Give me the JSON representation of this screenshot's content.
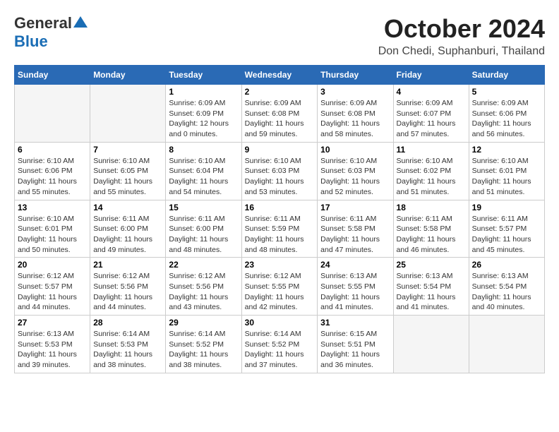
{
  "logo": {
    "general": "General",
    "blue": "Blue"
  },
  "title": "October 2024",
  "location": "Don Chedi, Suphanburi, Thailand",
  "days_of_week": [
    "Sunday",
    "Monday",
    "Tuesday",
    "Wednesday",
    "Thursday",
    "Friday",
    "Saturday"
  ],
  "weeks": [
    [
      {
        "num": "",
        "empty": true
      },
      {
        "num": "",
        "empty": true
      },
      {
        "num": "1",
        "info": "Sunrise: 6:09 AM\nSunset: 6:09 PM\nDaylight: 12 hours and 0 minutes."
      },
      {
        "num": "2",
        "info": "Sunrise: 6:09 AM\nSunset: 6:08 PM\nDaylight: 11 hours and 59 minutes."
      },
      {
        "num": "3",
        "info": "Sunrise: 6:09 AM\nSunset: 6:08 PM\nDaylight: 11 hours and 58 minutes."
      },
      {
        "num": "4",
        "info": "Sunrise: 6:09 AM\nSunset: 6:07 PM\nDaylight: 11 hours and 57 minutes."
      },
      {
        "num": "5",
        "info": "Sunrise: 6:09 AM\nSunset: 6:06 PM\nDaylight: 11 hours and 56 minutes."
      }
    ],
    [
      {
        "num": "6",
        "info": "Sunrise: 6:10 AM\nSunset: 6:06 PM\nDaylight: 11 hours and 55 minutes."
      },
      {
        "num": "7",
        "info": "Sunrise: 6:10 AM\nSunset: 6:05 PM\nDaylight: 11 hours and 55 minutes."
      },
      {
        "num": "8",
        "info": "Sunrise: 6:10 AM\nSunset: 6:04 PM\nDaylight: 11 hours and 54 minutes."
      },
      {
        "num": "9",
        "info": "Sunrise: 6:10 AM\nSunset: 6:03 PM\nDaylight: 11 hours and 53 minutes."
      },
      {
        "num": "10",
        "info": "Sunrise: 6:10 AM\nSunset: 6:03 PM\nDaylight: 11 hours and 52 minutes."
      },
      {
        "num": "11",
        "info": "Sunrise: 6:10 AM\nSunset: 6:02 PM\nDaylight: 11 hours and 51 minutes."
      },
      {
        "num": "12",
        "info": "Sunrise: 6:10 AM\nSunset: 6:01 PM\nDaylight: 11 hours and 51 minutes."
      }
    ],
    [
      {
        "num": "13",
        "info": "Sunrise: 6:10 AM\nSunset: 6:01 PM\nDaylight: 11 hours and 50 minutes."
      },
      {
        "num": "14",
        "info": "Sunrise: 6:11 AM\nSunset: 6:00 PM\nDaylight: 11 hours and 49 minutes."
      },
      {
        "num": "15",
        "info": "Sunrise: 6:11 AM\nSunset: 6:00 PM\nDaylight: 11 hours and 48 minutes."
      },
      {
        "num": "16",
        "info": "Sunrise: 6:11 AM\nSunset: 5:59 PM\nDaylight: 11 hours and 48 minutes."
      },
      {
        "num": "17",
        "info": "Sunrise: 6:11 AM\nSunset: 5:58 PM\nDaylight: 11 hours and 47 minutes."
      },
      {
        "num": "18",
        "info": "Sunrise: 6:11 AM\nSunset: 5:58 PM\nDaylight: 11 hours and 46 minutes."
      },
      {
        "num": "19",
        "info": "Sunrise: 6:11 AM\nSunset: 5:57 PM\nDaylight: 11 hours and 45 minutes."
      }
    ],
    [
      {
        "num": "20",
        "info": "Sunrise: 6:12 AM\nSunset: 5:57 PM\nDaylight: 11 hours and 44 minutes."
      },
      {
        "num": "21",
        "info": "Sunrise: 6:12 AM\nSunset: 5:56 PM\nDaylight: 11 hours and 44 minutes."
      },
      {
        "num": "22",
        "info": "Sunrise: 6:12 AM\nSunset: 5:56 PM\nDaylight: 11 hours and 43 minutes."
      },
      {
        "num": "23",
        "info": "Sunrise: 6:12 AM\nSunset: 5:55 PM\nDaylight: 11 hours and 42 minutes."
      },
      {
        "num": "24",
        "info": "Sunrise: 6:13 AM\nSunset: 5:55 PM\nDaylight: 11 hours and 41 minutes."
      },
      {
        "num": "25",
        "info": "Sunrise: 6:13 AM\nSunset: 5:54 PM\nDaylight: 11 hours and 41 minutes."
      },
      {
        "num": "26",
        "info": "Sunrise: 6:13 AM\nSunset: 5:54 PM\nDaylight: 11 hours and 40 minutes."
      }
    ],
    [
      {
        "num": "27",
        "info": "Sunrise: 6:13 AM\nSunset: 5:53 PM\nDaylight: 11 hours and 39 minutes."
      },
      {
        "num": "28",
        "info": "Sunrise: 6:14 AM\nSunset: 5:53 PM\nDaylight: 11 hours and 38 minutes."
      },
      {
        "num": "29",
        "info": "Sunrise: 6:14 AM\nSunset: 5:52 PM\nDaylight: 11 hours and 38 minutes."
      },
      {
        "num": "30",
        "info": "Sunrise: 6:14 AM\nSunset: 5:52 PM\nDaylight: 11 hours and 37 minutes."
      },
      {
        "num": "31",
        "info": "Sunrise: 6:15 AM\nSunset: 5:51 PM\nDaylight: 11 hours and 36 minutes."
      },
      {
        "num": "",
        "empty": true
      },
      {
        "num": "",
        "empty": true
      }
    ]
  ]
}
